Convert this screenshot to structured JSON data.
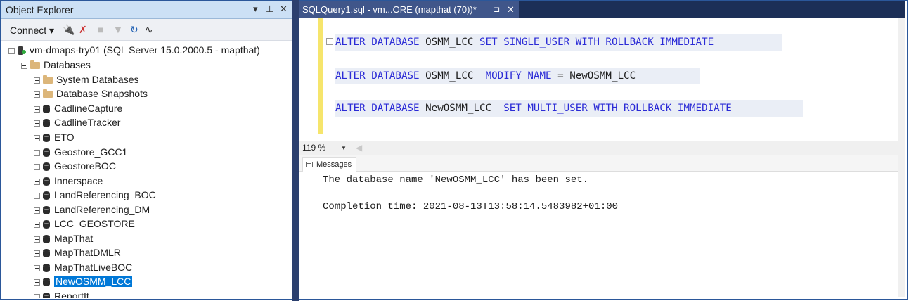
{
  "object_explorer": {
    "title": "Object Explorer",
    "title_controls": {
      "dropdown": "▾",
      "pin": "⊥",
      "close": "✕"
    },
    "toolbar": {
      "connect_label": "Connect ▾"
    },
    "server": "vm-dmaps-try01 (SQL Server 15.0.2000.5 - mapthat)",
    "databases_label": "Databases",
    "folders": [
      "System Databases",
      "Database Snapshots"
    ],
    "databases": [
      "CadlineCapture",
      "CadlineTracker",
      "ETO",
      "Geostore_GCC1",
      "GeostoreBOC",
      "Innerspace",
      "LandReferencing_BOC",
      "LandReferencing_DM",
      "LCC_GEOSTORE",
      "MapThat",
      "MapThatDMLR",
      "MapThatLiveBOC",
      "NewOSMM_LCC",
      "ReportIt"
    ],
    "selected": "NewOSMM_LCC"
  },
  "query_tab": {
    "label": "SQLQuery1.sql - vm...ORE (mapthat (70))*",
    "pin": "⊐",
    "close": "✕"
  },
  "code": {
    "line1": {
      "kw1": "ALTER DATABASE",
      "id1": "OSMM_LCC",
      "kw2": "SET SINGLE_USER WITH ROLLBACK IMMEDIATE"
    },
    "line2": {
      "kw1": "ALTER DATABASE",
      "id1": "OSMM_LCC",
      "kw2": "MODIFY NAME",
      "op": "=",
      "id2": "NewOSMM_LCC"
    },
    "line3": {
      "kw1": "ALTER DATABASE",
      "id1": "NewOSMM_LCC",
      "kw2": "SET MULTI_USER WITH ROLLBACK IMMEDIATE"
    }
  },
  "zoom": "119 %",
  "results": {
    "tab_label": "Messages",
    "message1": "The database name 'NewOSMM_LCC' has been set.",
    "message2": "Completion time: 2021-08-13T13:58:14.5483982+01:00"
  }
}
